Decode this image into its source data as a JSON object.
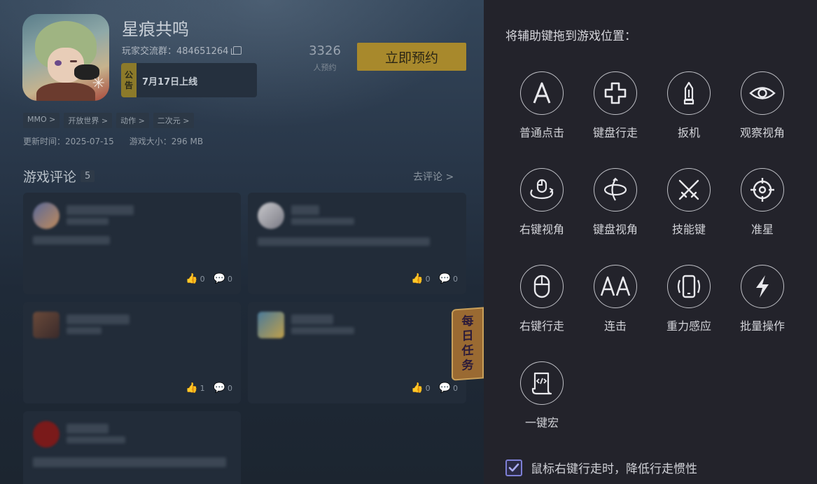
{
  "game": {
    "title": "星痕共鸣",
    "group_label": "玩家交流群：484651264",
    "notice_tag": "公告",
    "notice_tag_line1": "公",
    "notice_tag_line2": "告",
    "notice_text": "7月17日上线",
    "reserve_count": "3326",
    "reserve_label": "人预约",
    "reserve_button": "立即预约",
    "tags": [
      "MMO >",
      "开放世界 >",
      "动作 >",
      "二次元 >"
    ],
    "update_time": "更新时间：2025-07-15",
    "game_size": "游戏大小：296 MB"
  },
  "reviews": {
    "title": "游戏评论",
    "count": "5",
    "go_review": "去评论 >",
    "cards": [
      {
        "likes": "0",
        "comments": "0"
      },
      {
        "likes": "0",
        "comments": "0"
      },
      {
        "likes": "1",
        "comments": "0"
      },
      {
        "likes": "0",
        "comments": "0"
      }
    ]
  },
  "daily_task": {
    "line1": "每",
    "line2": "日",
    "line3": "任",
    "line4": "务"
  },
  "panel": {
    "title": "将辅助键拖到游戏位置：",
    "keys": [
      {
        "label": "普通点击",
        "icon": "letter-a-icon"
      },
      {
        "label": "键盘行走",
        "icon": "dpad-cross-icon"
      },
      {
        "label": "扳机",
        "icon": "bullet-icon"
      },
      {
        "label": "观察视角",
        "icon": "eye-icon"
      },
      {
        "label": "右键视角",
        "icon": "mouse-orbit-icon"
      },
      {
        "label": "键盘视角",
        "icon": "rotate-3d-icon"
      },
      {
        "label": "技能键",
        "icon": "crossed-swords-icon"
      },
      {
        "label": "准星",
        "icon": "crosshair-icon"
      },
      {
        "label": "右键行走",
        "icon": "mouse-icon"
      },
      {
        "label": "连击",
        "icon": "double-a-icon"
      },
      {
        "label": "重力感应",
        "icon": "phone-vibrate-icon"
      },
      {
        "label": "批量操作",
        "icon": "lightning-icon"
      },
      {
        "label": "一键宏",
        "icon": "script-scroll-icon"
      }
    ],
    "checkbox_label": "鼠标右键行走时，降低行走惯性",
    "checkbox_checked": true,
    "accent_color": "#7d7fd6"
  }
}
